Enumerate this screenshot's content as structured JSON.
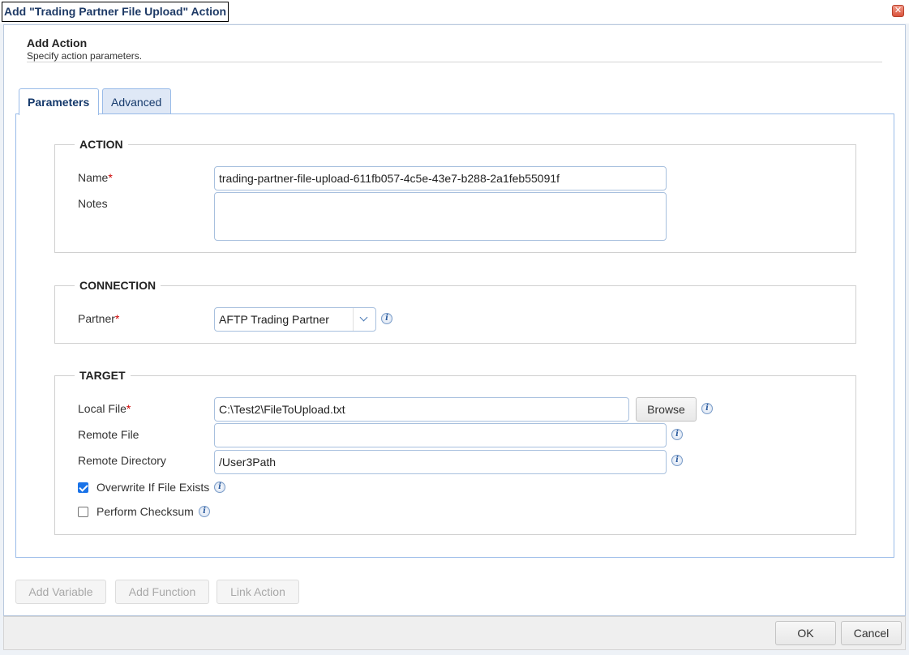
{
  "dialog": {
    "title": "Add \"Trading Partner File Upload\" Action",
    "close_glyph": "✕"
  },
  "header": {
    "title": "Add Action",
    "subtitle": "Specify action parameters."
  },
  "tabs": [
    {
      "label": "Parameters",
      "active": true
    },
    {
      "label": "Advanced",
      "active": false
    }
  ],
  "action_section": {
    "legend": "ACTION",
    "name_label": "Name",
    "name_value": "trading-partner-file-upload-611fb057-4c5e-43e7-b288-2a1feb55091f",
    "notes_label": "Notes",
    "notes_value": ""
  },
  "connection_section": {
    "legend": "CONNECTION",
    "partner_label": "Partner",
    "partner_value": "AFTP Trading Partner"
  },
  "target_section": {
    "legend": "TARGET",
    "local_file_label": "Local File",
    "local_file_value": "C:\\Test2\\FileToUpload.txt",
    "browse_label": "Browse",
    "remote_file_label": "Remote File",
    "remote_file_value": "",
    "remote_dir_label": "Remote Directory",
    "remote_dir_value": "/User3Path",
    "overwrite_label": "Overwrite If File Exists",
    "overwrite_checked": true,
    "checksum_label": "Perform Checksum",
    "checksum_checked": false
  },
  "required_marker": "*",
  "info_glyph": "i",
  "toolbar": {
    "add_variable": "Add Variable",
    "add_function": "Add Function",
    "link_action": "Link Action"
  },
  "footer": {
    "ok": "OK",
    "cancel": "Cancel"
  }
}
